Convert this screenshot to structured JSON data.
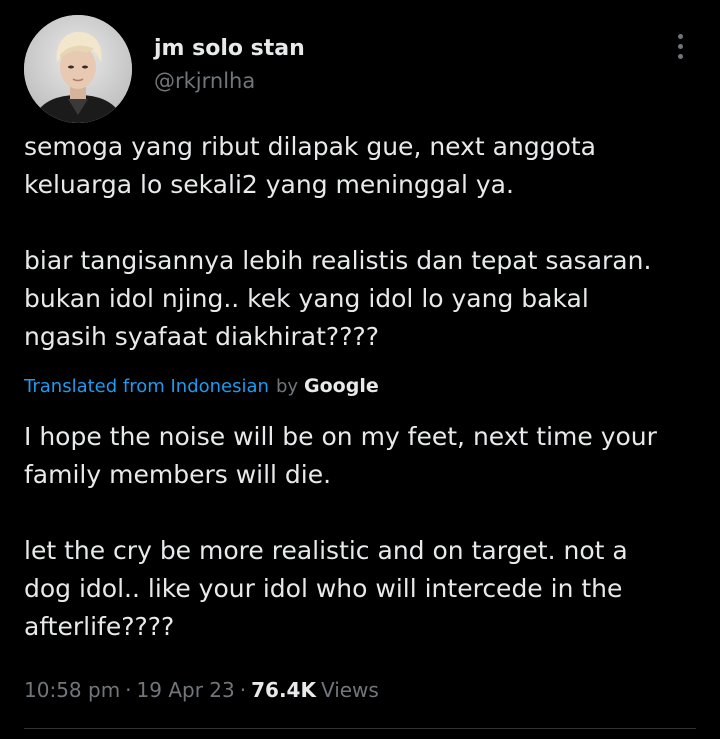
{
  "author": {
    "display_name": "jm solo stan",
    "handle": "@rkjrnlha"
  },
  "tweet": {
    "original_text": "semoga yang ribut dilapak gue, next anggota\nkeluarga lo sekali2 yang meninggal ya.\n\nbiar tangisannya lebih realistis dan tepat sasaran.\nbukan idol njing.. kek yang idol lo yang bakal\nngasih syafaat diakhirat????",
    "translation_link": "Translated from Indonesian",
    "translation_by": "by",
    "translation_provider": "Google",
    "translated_text": "I hope the noise will be on my feet, next time your\nfamily members will die.\n\nlet the cry be more realistic and on target. not a\ndog idol.. like your idol who will intercede in the\nafterlife????",
    "time": "10:58 pm",
    "date": "19 Apr 23",
    "views_count": "76.4K",
    "views_label": "Views",
    "separator": "·"
  },
  "icons": {
    "more": "more-vertical-icon"
  },
  "colors": {
    "background": "#000000",
    "text_primary": "#e7e9ea",
    "text_secondary": "#71767b",
    "link": "#1d9bf0",
    "divider": "#2f3336"
  }
}
